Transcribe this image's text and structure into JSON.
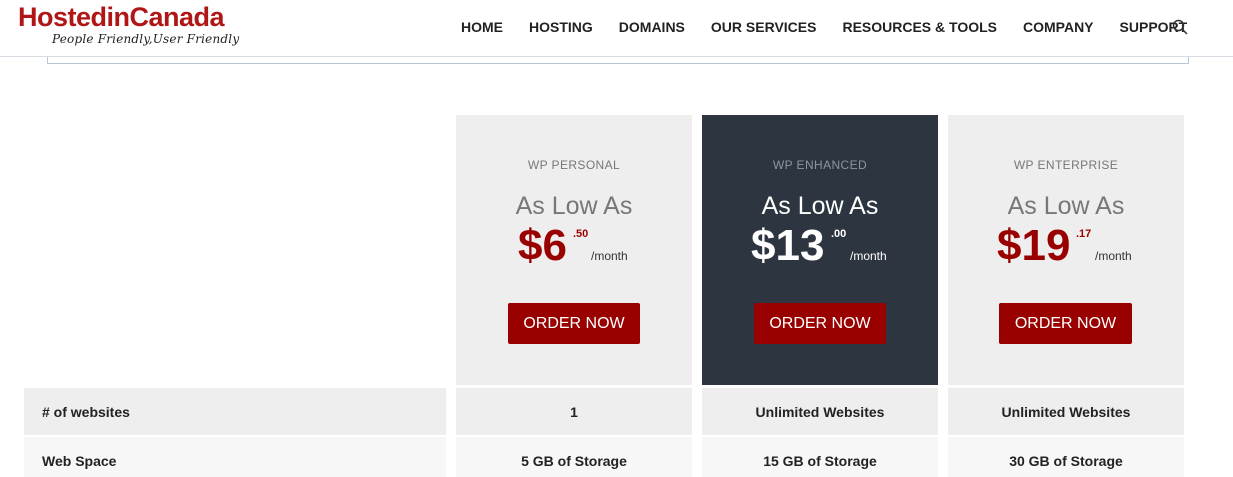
{
  "header": {
    "logo": {
      "part1": "Hosted",
      "part2": "in",
      "part3": "Canada",
      "tagline": "People Friendly,User Friendly"
    },
    "nav": [
      "HOME",
      "HOSTING",
      "DOMAINS",
      "OUR SERVICES",
      "RESOURCES & TOOLS",
      "COMPANY",
      "SUPPORT"
    ],
    "search_icon": "search-icon"
  },
  "plans": [
    {
      "name": "WP PERSONAL",
      "as_low": "As Low As",
      "dollars": "$6",
      "cents": ".50",
      "per": "/month",
      "order": "ORDER NOW",
      "style": "light"
    },
    {
      "name": "WP ENHANCED",
      "as_low": "As Low As",
      "dollars": "$13",
      "cents": ".00",
      "per": "/month",
      "order": "ORDER NOW",
      "style": "dark"
    },
    {
      "name": "WP ENTERPRISE",
      "as_low": "As Low As",
      "dollars": "$19",
      "cents": ".17",
      "per": "/month",
      "order": "ORDER NOW",
      "style": "light"
    }
  ],
  "features": [
    {
      "label": "# of websites",
      "values": [
        "1",
        "Unlimited Websites",
        "Unlimited Websites"
      ]
    },
    {
      "label": "Web Space",
      "values": [
        "5 GB of Storage",
        "15 GB of Storage",
        "30 GB of Storage"
      ]
    }
  ],
  "colors": {
    "brand_red": "#990000",
    "dark_column": "#2c3540",
    "light_column": "#eeeeee"
  }
}
